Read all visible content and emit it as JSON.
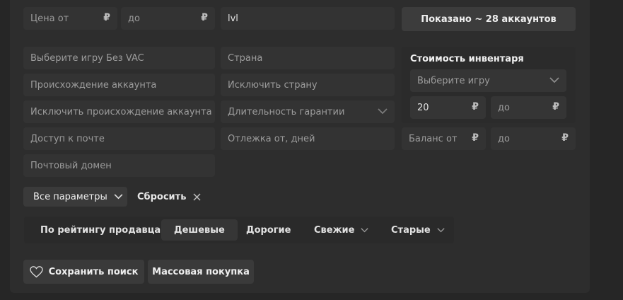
{
  "top_row": {
    "price_from_placeholder": "Цена от",
    "price_to_placeholder": "до",
    "currency": "₽",
    "search_value": "lvl",
    "shown_button": "Показано ~ 28 аккаунтов"
  },
  "filters_left": [
    "Выберите игру Без VAC",
    "Происхождение аккаунта",
    "Исключить происхождение аккаунта",
    "Доступ к почте",
    "Почтовый домен"
  ],
  "filters_middle": [
    "Страна",
    "Исключить страну",
    "Длительность гарантии",
    "Отлежка от, дней"
  ],
  "inventory": {
    "title": "Стоимость инвентаря",
    "game_placeholder": "Выберите игру",
    "from_value": "20",
    "to_placeholder": "до"
  },
  "balance": {
    "from_placeholder": "Баланс от",
    "to_placeholder": "до"
  },
  "actions": {
    "all_params": "Все параметры",
    "reset": "Сбросить"
  },
  "sort": {
    "items": [
      "По рейтингу продавца",
      "Дешевые",
      "Дорогие",
      "Свежие",
      "Старые"
    ],
    "active_index": 1
  },
  "bottom": {
    "save_search": "Сохранить поиск",
    "bulk_buy": "Массовая покупка"
  }
}
